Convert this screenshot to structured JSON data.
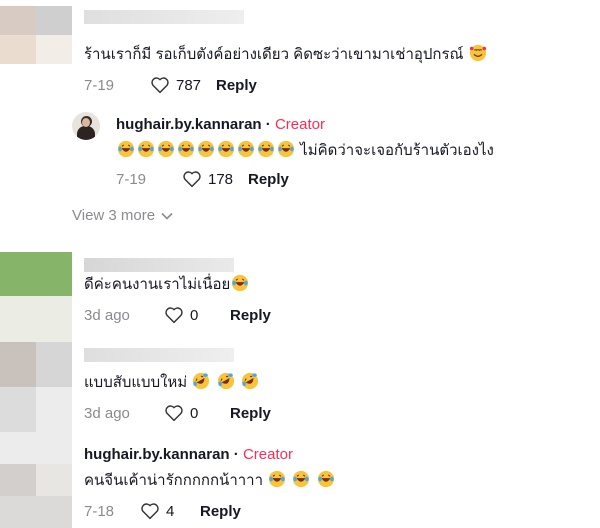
{
  "comments": [
    {
      "text": "ร้านเราก็มี รอเก็บตังค์อย่างเดียว คิดซะว่าเขามาเช่าอุปกรณ์",
      "emoji": "smiling-hearts",
      "date": "7-19",
      "likes": "787",
      "reply_label": "Reply"
    },
    {
      "author": "hughair.by.kannaran",
      "badge": "Creator",
      "text": "ไม่คิดว่าจะเจอกับร้านตัวเองไง",
      "emoji": "laughing-tears",
      "date": "7-19",
      "likes": "178",
      "reply_label": "Reply"
    },
    {
      "text": "ดีค่ะคนงานเราไม่เนื่อย",
      "emoji": "laughing-tears",
      "date": "3d ago",
      "likes": "0",
      "reply_label": "Reply"
    },
    {
      "text": "แบบสับแบบใหม่",
      "emoji": "rolling-laughing",
      "date": "3d ago",
      "likes": "0",
      "reply_label": "Reply"
    },
    {
      "author": "hughair.by.kannaran",
      "badge": "Creator",
      "text": "คนจีนเค้าน่ารักกกกกน้าาาา",
      "emoji": "laughing-tears",
      "date": "7-18",
      "likes": "4",
      "reply_label": "Reply"
    }
  ],
  "view_more": {
    "label": "View 3 more",
    "icon": "chevron-down-icon"
  },
  "colors": {
    "creator_badge": "#fe2c55",
    "muted": "#8a8b91",
    "text": "#161823"
  }
}
